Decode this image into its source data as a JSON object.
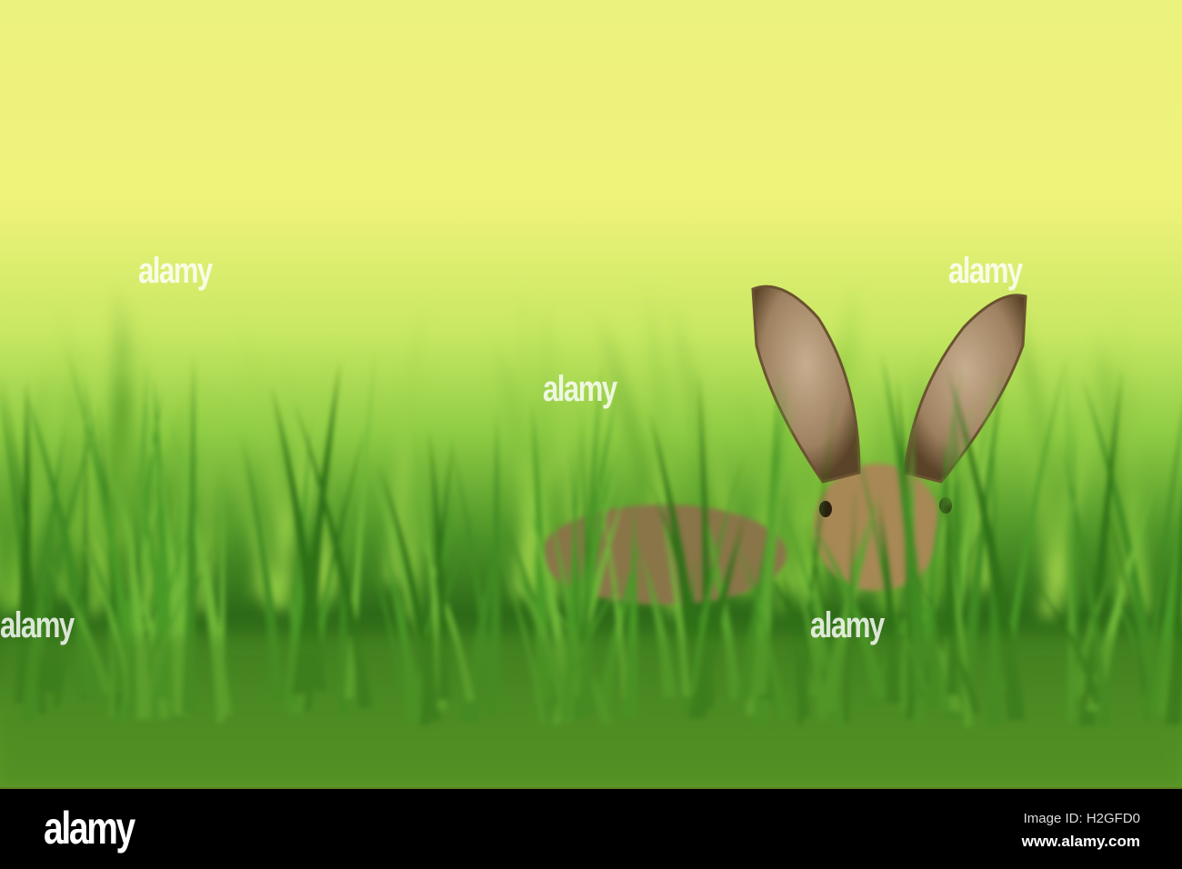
{
  "watermark": {
    "logo": "alamy"
  },
  "footer": {
    "logo": "alamy",
    "image_id": "Image ID: H2GFD0",
    "url": "www.alamy.com"
  },
  "colors": {
    "sky": "#eef37c",
    "grass_mid": "#7fc13a",
    "grass_dark": "#2c6415",
    "hare": "#8c7446",
    "footer_bg": "#000000"
  }
}
